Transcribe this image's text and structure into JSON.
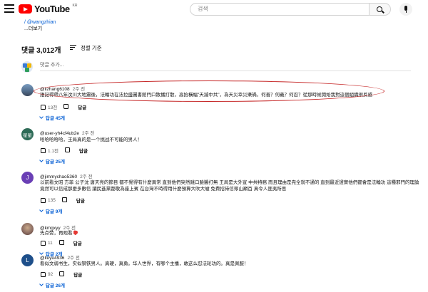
{
  "header": {
    "logo_text": "YouTube",
    "logo_country": "KR",
    "search_placeholder": "검색"
  },
  "description": {
    "link_text": "/ @wangzhian",
    "more_label": "...더보기"
  },
  "comments_header": {
    "count_label": "댓글 3,012개",
    "sort_label": "정렬 기준"
  },
  "add_comment": {
    "placeholder": "댓글 추가..."
  },
  "comments": [
    {
      "author": "@lizhang6108",
      "time": "2주 전",
      "text": "誰記得帶八年汶川大地震後，法輪功在法拉盛圖書館門口散播打散，高抬橫幅\"天滅中共\"，為天災幸災樂禍，何善？何義？何忍？從那時候開始我對這個組織很反感",
      "likes": "13천",
      "reply_label": "답글",
      "replies_label": "답글 45개",
      "avatar_color": "#5b6f86"
    },
    {
      "author": "@user-yh4cf4ub2e",
      "time": "2주 전",
      "text_lines": [
        "哈哈哈哈哈，王局真的是一个挑战不可能的男人！"
      ],
      "likes": "1.1천",
      "reply_label": "답글",
      "replies_label": "답글 25개",
      "avatar_text": "星星",
      "avatar_color": "#2e6b57"
    },
    {
      "author": "@jimmychao5360",
      "time": "2주 전",
      "text_lines": [
        "以前看文昭 方菲 公子沈 唐天亮的節目 都不覺得有什麼異常 直到他們突然跳口臉醬打無 王局是大外宣 中共特務 而且理由是完全就不通的 直到最近證實他們都會是法輪功 這種邪門的理論",
        "竟然可以信成那麼多數信 讓民進黨都敬為座上賓 在台灣不時得用什麼預算大吹大噓 免費招待信眾山巔百 真令人匪夷所思"
      ],
      "likes": "135",
      "reply_label": "답글",
      "replies_label": "답글 9개",
      "avatar_text": "J",
      "avatar_color": "#6a3fb5"
    },
    {
      "author": "@kmgxyy",
      "time": "2주 전",
      "text_lines": [
        "先点赞，再观看"
      ],
      "likes": "11",
      "reply_label": "답글",
      "replies_label": "답글 2개",
      "avatar_color": "#8d6e63"
    },
    {
      "author": "@liuyu4936",
      "time": "2주 전",
      "text_lines": [
        "看似文弱书生，实似钢铁男人。真硬，真勇。华人世界，有哪个主播，敢这么怼法轮功的。真是佩服！"
      ],
      "likes": "92",
      "reply_label": "답글",
      "replies_label": "답글 26개",
      "avatar_text": "L",
      "avatar_color": "#1e4f8a"
    }
  ]
}
